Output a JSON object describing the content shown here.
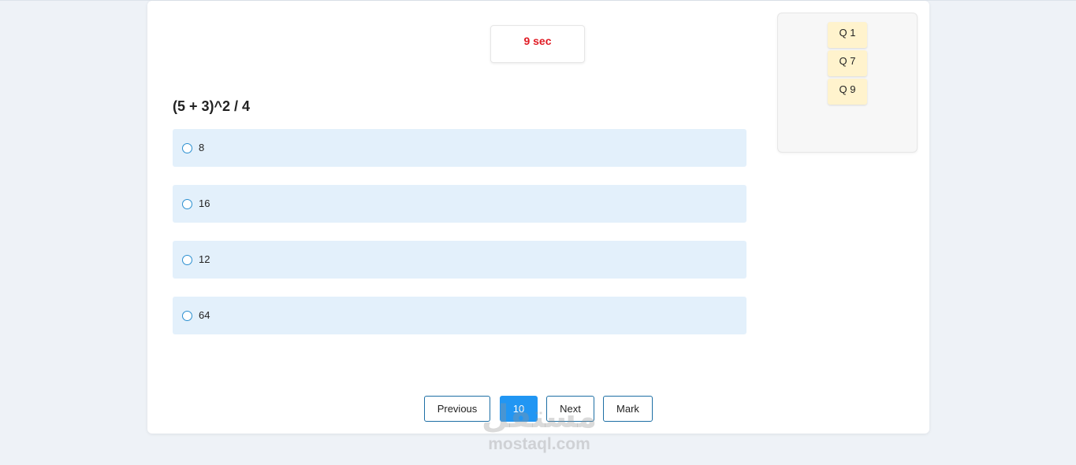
{
  "timer": {
    "text": "9 sec",
    "color": "#e01b24"
  },
  "question": {
    "text": "(5 + 3)^2 / 4"
  },
  "options": [
    {
      "label": "8"
    },
    {
      "label": "16"
    },
    {
      "label": "12"
    },
    {
      "label": "64"
    }
  ],
  "navigation": {
    "previous_label": "Previous",
    "current_page": "10",
    "next_label": "Next",
    "mark_label": "Mark"
  },
  "marked_questions": [
    {
      "label": "Q 1"
    },
    {
      "label": "Q 7"
    },
    {
      "label": "Q 9"
    }
  ],
  "watermark": {
    "logo": "مستقل",
    "text": "mostaql.com"
  },
  "colors": {
    "accent": "#2196f3",
    "option_background": "#e3f0fb",
    "marked_chip": "#fff3cd",
    "page_background": "#eef2f7"
  },
  "icons": {
    "option_marker": "radio-button-icon"
  }
}
